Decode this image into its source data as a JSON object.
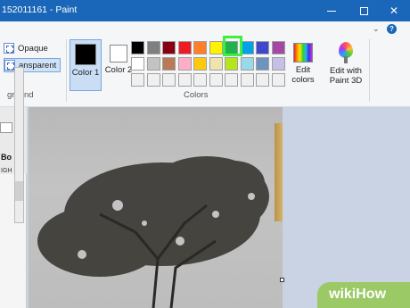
{
  "window": {
    "title": "152011161 - Paint"
  },
  "ribbon": {
    "selection_options": {
      "opaque_label": "Opaque",
      "transparent_label": "ansparent",
      "group_label": "ground"
    },
    "color1_label": "Color 1",
    "color2_label": "Color 2",
    "colors_group_label": "Colors",
    "edit_colors_label": "Edit colors",
    "edit_paint3d_label": "Edit with Paint 3D",
    "palette": [
      [
        "#000000",
        "#7f7f7f",
        "#880015",
        "#ed1c24",
        "#ff7f27",
        "#fff200",
        "#22b14c",
        "#00a2e8",
        "#3f48cc",
        "#a349a4"
      ],
      [
        "#ffffff",
        "#c3c3c3",
        "#b97a57",
        "#ffaec9",
        "#ffc90e",
        "#efe4b0",
        "#b5e61d",
        "#99d9ea",
        "#7092be",
        "#c8bfe7"
      ],
      [
        "#f0f0f0",
        "#f0f0f0",
        "#f0f0f0",
        "#f0f0f0",
        "#f0f0f0",
        "#f0f0f0",
        "#f0f0f0",
        "#f0f0f0",
        "#f0f0f0",
        "#f0f0f0"
      ]
    ],
    "highlighted_color": "#22b14c"
  },
  "left_panel": {
    "text_bold": "Bo",
    "text_small": "IGH"
  },
  "watermark": {
    "text": "wikiHow"
  }
}
